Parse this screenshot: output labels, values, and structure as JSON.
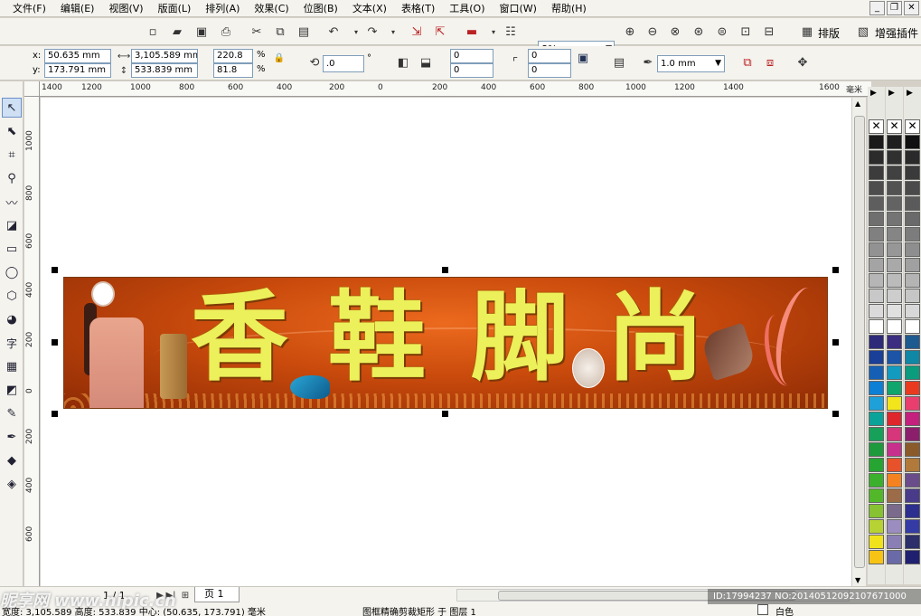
{
  "menu": [
    "文件(F)",
    "编辑(E)",
    "视图(V)",
    "版面(L)",
    "排列(A)",
    "效果(C)",
    "位图(B)",
    "文本(X)",
    "表格(T)",
    "工具(O)",
    "窗口(W)",
    "帮助(H)"
  ],
  "window_controls": {
    "minimize": "_",
    "restore": "❐",
    "close": "✕"
  },
  "toolbar": {
    "zoom": "8%",
    "layout_button": "排版",
    "plugin_button": "增强插件"
  },
  "property_bar": {
    "x_label": "x:",
    "y_label": "y:",
    "x_value": "50.635 mm",
    "y_value": "173.791 mm",
    "width_value": "3,105.589 mm",
    "height_value": "533.839 mm",
    "scale_w": "220.8",
    "scale_h": "81.8",
    "percent": "%",
    "rotation": ".0",
    "degree": "°",
    "corner_1": "0",
    "corner_2": "0",
    "corner_3": "0",
    "corner_4": "0",
    "outline_width": "1.0 mm"
  },
  "ruler": {
    "top_ticks": [
      "1400",
      "1200",
      "1000",
      "800",
      "600",
      "400",
      "200",
      "0",
      "200",
      "400",
      "600",
      "800",
      "1000",
      "1200",
      "1400",
      "1600"
    ],
    "unit": "毫米",
    "left_ticks": [
      "1000",
      "800",
      "600",
      "400",
      "200",
      "0",
      "200",
      "400",
      "600"
    ]
  },
  "banner": {
    "chars": [
      "香",
      "鞋",
      "脚",
      "尚"
    ]
  },
  "page_nav": {
    "page_count": "1 / 1",
    "page_tab": "页 1"
  },
  "status": {
    "left": "宽度: 3,105.589 高度: 533.839 中心: (50.635, 173.791) 毫米",
    "middle": "图框精确剪裁矩形 于 图层 1",
    "right": "白色"
  },
  "watermark": {
    "text": "昵享网 www.nipic.cn",
    "id": "ID:17994237 NO:20140512092107671000"
  },
  "palette_colors": {
    "column_1": [
      "#1a1a1a",
      "#2b2b2b",
      "#3c3c3c",
      "#4d4d4d",
      "#5e5e5e",
      "#6f6f6f",
      "#808080",
      "#929292",
      "#a4a4a4",
      "#b6b6b6",
      "#c8c8c8",
      "#dadada",
      "#ffffff",
      "#2e2a7a",
      "#1a3f99",
      "#1560b5",
      "#0d7fd4",
      "#1fa0d8",
      "#0aa39a",
      "#16a05a",
      "#1d9a3c",
      "#26a532",
      "#3bb02c",
      "#52b82a",
      "#86c232",
      "#b7d233",
      "#f1e31b",
      "#f7c315"
    ],
    "column_2": [
      "#1f1f1f",
      "#303030",
      "#414141",
      "#525252",
      "#636363",
      "#747474",
      "#858585",
      "#979797",
      "#a9a9a9",
      "#bbbbbb",
      "#cdcdcd",
      "#e0e0e0",
      "#ffffff",
      "#3b2d80",
      "#1c54a7",
      "#139bbf",
      "#0fa56c",
      "#f2e51c",
      "#e0262d",
      "#d6367a",
      "#c8308e",
      "#e8522a",
      "#f58220",
      "#9c6b47",
      "#7a6a8c",
      "#9b8dbf",
      "#8a7fb5",
      "#6a6aa8"
    ],
    "column_3": [
      "#101010",
      "#2a2a2a",
      "#3a3a3a",
      "#4a4a4a",
      "#5a5a5a",
      "#6a6a6a",
      "#7c7c7c",
      "#8e8e8e",
      "#a0a0a0",
      "#b4b4b4",
      "#c6c6c6",
      "#d8d8d8",
      "#ffffff",
      "#1d5a8f",
      "#0f87a5",
      "#0b9b7d",
      "#e93a1f",
      "#ea3e6f",
      "#c4207e",
      "#8b1f6b",
      "#8a5a2a",
      "#b27a3a",
      "#6b4c8a",
      "#4a3b8a",
      "#2d2f8f",
      "#353ba5",
      "#2c2f6a",
      "#202070"
    ]
  }
}
